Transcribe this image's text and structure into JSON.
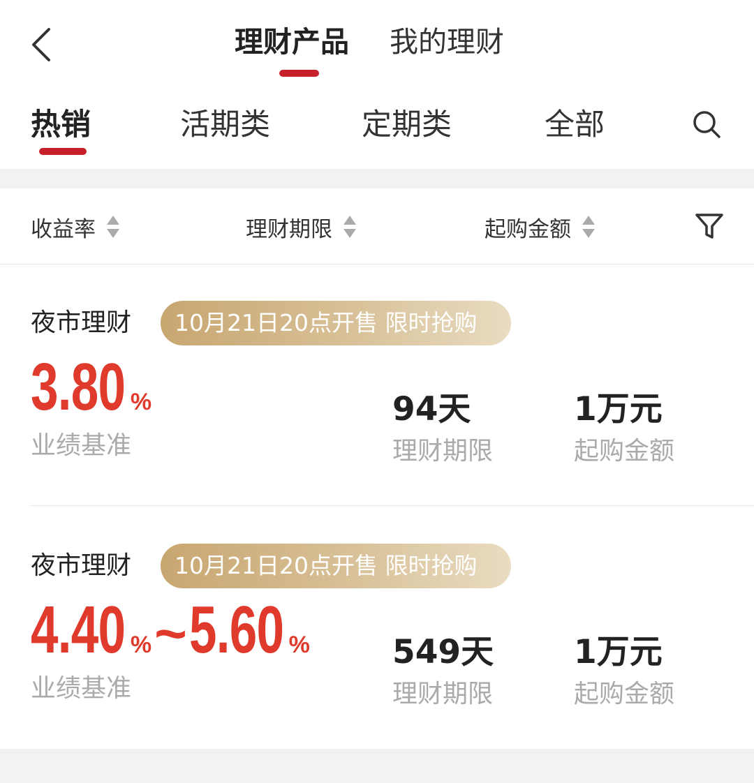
{
  "header": {
    "tabs": [
      {
        "label": "理财产品",
        "active": true
      },
      {
        "label": "我的理财",
        "active": false
      }
    ],
    "back_icon": "chevron-left-icon"
  },
  "categories": {
    "tabs": [
      {
        "label": "热销",
        "active": true
      },
      {
        "label": "活期类",
        "active": false
      },
      {
        "label": "定期类",
        "active": false
      },
      {
        "label": "全部",
        "active": false
      }
    ],
    "search_icon": "search-icon"
  },
  "sort_bar": {
    "items": [
      {
        "label": "收益率"
      },
      {
        "label": "理财期限"
      },
      {
        "label": "起购金额"
      }
    ],
    "filter_icon": "filter-icon"
  },
  "products": [
    {
      "name": "夜市理财",
      "badge": "10月21日20点开售 限时抢购",
      "rate_low": "3.80",
      "rate_high": "",
      "rate_label": "业绩基准",
      "term": "94天",
      "term_label": "理财期限",
      "min_amount": "1万元",
      "min_amount_label": "起购金额"
    },
    {
      "name": "夜市理财",
      "badge": "10月21日20点开售 限时抢购",
      "rate_low": "4.40",
      "rate_high": "5.60",
      "rate_label": "业绩基准",
      "term": "549天",
      "term_label": "理财期限",
      "min_amount": "1万元",
      "min_amount_label": "起购金额"
    }
  ],
  "symbols": {
    "percent": "%",
    "range": "~"
  },
  "colors": {
    "accent": "#c8202a",
    "rate": "#e03a2c",
    "badge_start": "#c8a670",
    "badge_end": "#e9dcc1"
  }
}
